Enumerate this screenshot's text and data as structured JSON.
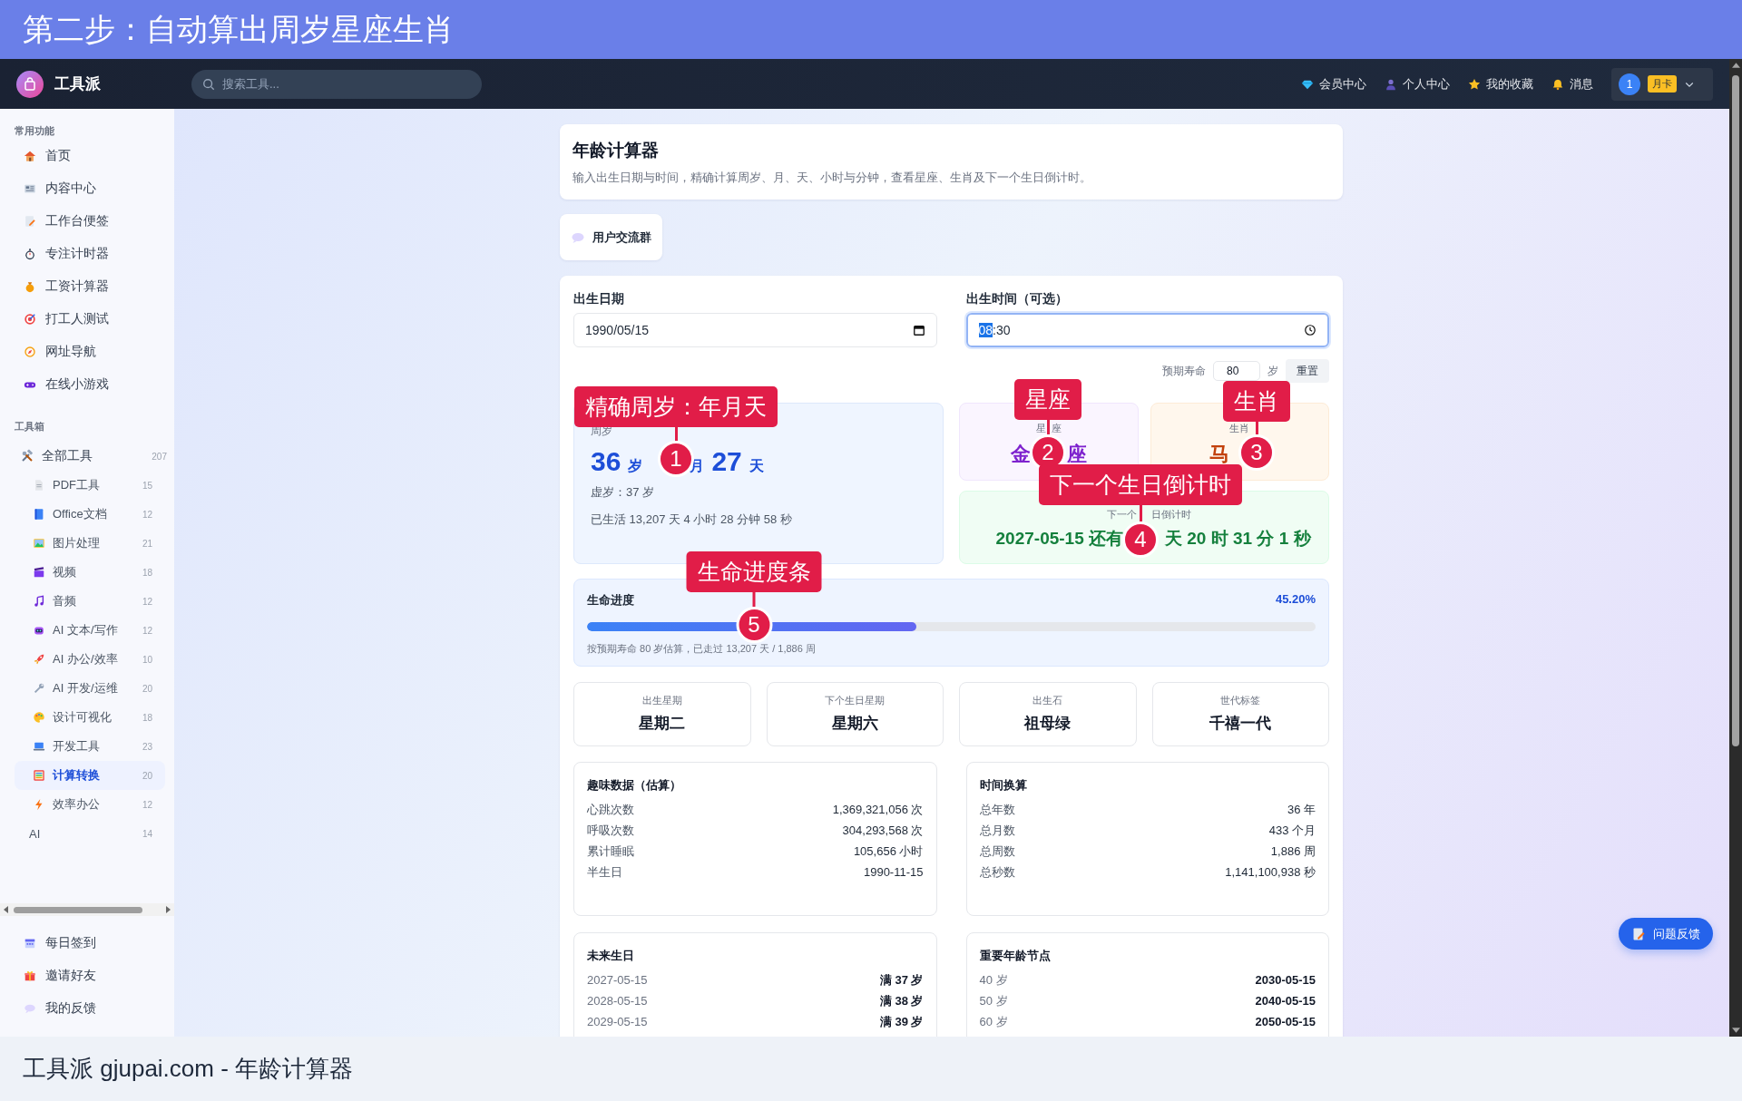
{
  "banner": {
    "title": "第二步：自动算出周岁星座生肖"
  },
  "navbar": {
    "brand": "工具派",
    "search": {
      "placeholder": "搜索工具..."
    },
    "links": [
      {
        "label": "会员中心"
      },
      {
        "label": "个人中心"
      },
      {
        "label": "我的收藏"
      },
      {
        "label": "消息"
      }
    ],
    "user": {
      "avatar": "1",
      "badge": "月卡"
    }
  },
  "sidebar": {
    "sections": [
      {
        "title": "常用功能",
        "items": [
          {
            "label": "首页",
            "selected": false
          },
          {
            "label": "内容中心",
            "selected": false
          },
          {
            "label": "工作台便签",
            "selected": false
          },
          {
            "label": "专注计时器",
            "selected": false
          },
          {
            "label": "工资计算器",
            "selected": false
          },
          {
            "label": "打工人测试",
            "selected": false
          },
          {
            "label": "网址导航",
            "selected": false
          },
          {
            "label": "在线小游戏",
            "selected": false
          }
        ]
      },
      {
        "title": "工具箱",
        "items": [
          {
            "label": "全部工具",
            "count": "207",
            "selected": false,
            "children": [
              {
                "label": "PDF工具",
                "count": "15",
                "selected": false
              },
              {
                "label": "Office文档",
                "count": "12",
                "selected": false
              },
              {
                "label": "图片处理",
                "count": "21",
                "selected": false
              },
              {
                "label": "视频",
                "count": "18",
                "selected": false
              },
              {
                "label": "音频",
                "count": "12",
                "selected": false
              },
              {
                "label": "AI 文本/写作",
                "count": "12",
                "selected": false
              },
              {
                "label": "AI 办公/效率",
                "count": "10",
                "selected": false
              },
              {
                "label": "AI 开发/运维",
                "count": "20",
                "selected": false
              },
              {
                "label": "设计可视化",
                "count": "18",
                "selected": false
              },
              {
                "label": "开发工具",
                "count": "23",
                "selected": false
              },
              {
                "label": "计算转换",
                "count": "20",
                "selected": true
              },
              {
                "label": "效率办公",
                "count": "12",
                "selected": false
              },
              {
                "label": "AI",
                "count": "14",
                "selected": false
              }
            ]
          }
        ]
      }
    ],
    "bottom_items": [
      {
        "label": "每日签到"
      },
      {
        "label": "邀请好友"
      },
      {
        "label": "我的反馈"
      }
    ]
  },
  "header": {
    "title": "年龄计算器",
    "description": "输入出生日期与时间，精确计算周岁、月、天、小时与分钟，查看星座、生肖及下一个生日倒计时。"
  },
  "community_button": "用户交流群",
  "form": {
    "birth_date": {
      "label": "出生日期",
      "value": "1990/05/15"
    },
    "birth_time": {
      "label": "出生时间（可选）",
      "selected_part": "08",
      "value_rest": ":30",
      "focused": true
    },
    "life_expectancy": {
      "label": "预期寿命",
      "value": "80",
      "unit": "岁"
    },
    "reset_button": "重置"
  },
  "age": {
    "label": "周岁",
    "years": "36",
    "years_unit": "岁",
    "months_unit": "月",
    "days": "27",
    "days_unit": "天",
    "nominal": "虚岁：37 岁",
    "lived": "已生活 13,207 天 4 小时 28 分钟 58 秒"
  },
  "zodiac": {
    "label_start": "星",
    "label_end": "座",
    "value_start": "金",
    "value_end": "座"
  },
  "chinese_zodiac": {
    "label": "生肖",
    "value": "马"
  },
  "countdown": {
    "label_start": "下一个",
    "label_end": "日倒计时",
    "value_start": "2027-05-15 还有",
    "value_end": "天 20 时 31 分 1 秒"
  },
  "progress": {
    "title": "生命进度",
    "percent": "45.20%",
    "level": 0.452,
    "note": "按预期寿命 80 岁估算，已走过 13,207 天 / 1,886 周"
  },
  "stats": [
    {
      "label": "出生星期",
      "value": "星期二"
    },
    {
      "label": "下个生日星期",
      "value": "星期六"
    },
    {
      "label": "出生石",
      "value": "祖母绿"
    },
    {
      "label": "世代标签",
      "value": "千禧一代"
    }
  ],
  "panels": [
    {
      "title": "趣味数据（估算）",
      "kind": "plain",
      "rows": [
        {
          "label": "心跳次数",
          "value": "1,369,321,056 次"
        },
        {
          "label": "呼吸次数",
          "value": "304,293,568 次"
        },
        {
          "label": "累计睡眠",
          "value": "105,656 小时"
        },
        {
          "label": "半生日",
          "value": "1990-11-15"
        }
      ]
    },
    {
      "title": "时间换算",
      "kind": "plain",
      "rows": [
        {
          "label": "总年数",
          "value": "36 年"
        },
        {
          "label": "总月数",
          "value": "433 个月"
        },
        {
          "label": "总周数",
          "value": "1,886 周"
        },
        {
          "label": "总秒数",
          "value": "1,141,100,938 秒"
        }
      ]
    },
    {
      "title": "未来生日",
      "kind": "emphasis",
      "rows": [
        {
          "label": "2027-05-15",
          "value": "满 37 岁"
        },
        {
          "label": "2028-05-15",
          "value": "满 38 岁"
        },
        {
          "label": "2029-05-15",
          "value": "满 39 岁"
        }
      ]
    },
    {
      "title": "重要年龄节点",
      "kind": "emphasis",
      "rows": [
        {
          "label": "40 岁",
          "value": "2030-05-15"
        },
        {
          "label": "50 岁",
          "value": "2040-05-15"
        },
        {
          "label": "60 岁",
          "value": "2050-05-15"
        }
      ]
    }
  ],
  "feedback_button": "问题反馈",
  "annotations": [
    {
      "label": "精确周岁：年月天",
      "number": "1"
    },
    {
      "label": "星座",
      "number": "2"
    },
    {
      "label": "生肖",
      "number": "3"
    },
    {
      "label": "下一个生日倒计时",
      "number": "4"
    },
    {
      "label": "生命进度条",
      "number": "5"
    }
  ],
  "caption": "工具派 gjupai.com - 年龄计算器"
}
